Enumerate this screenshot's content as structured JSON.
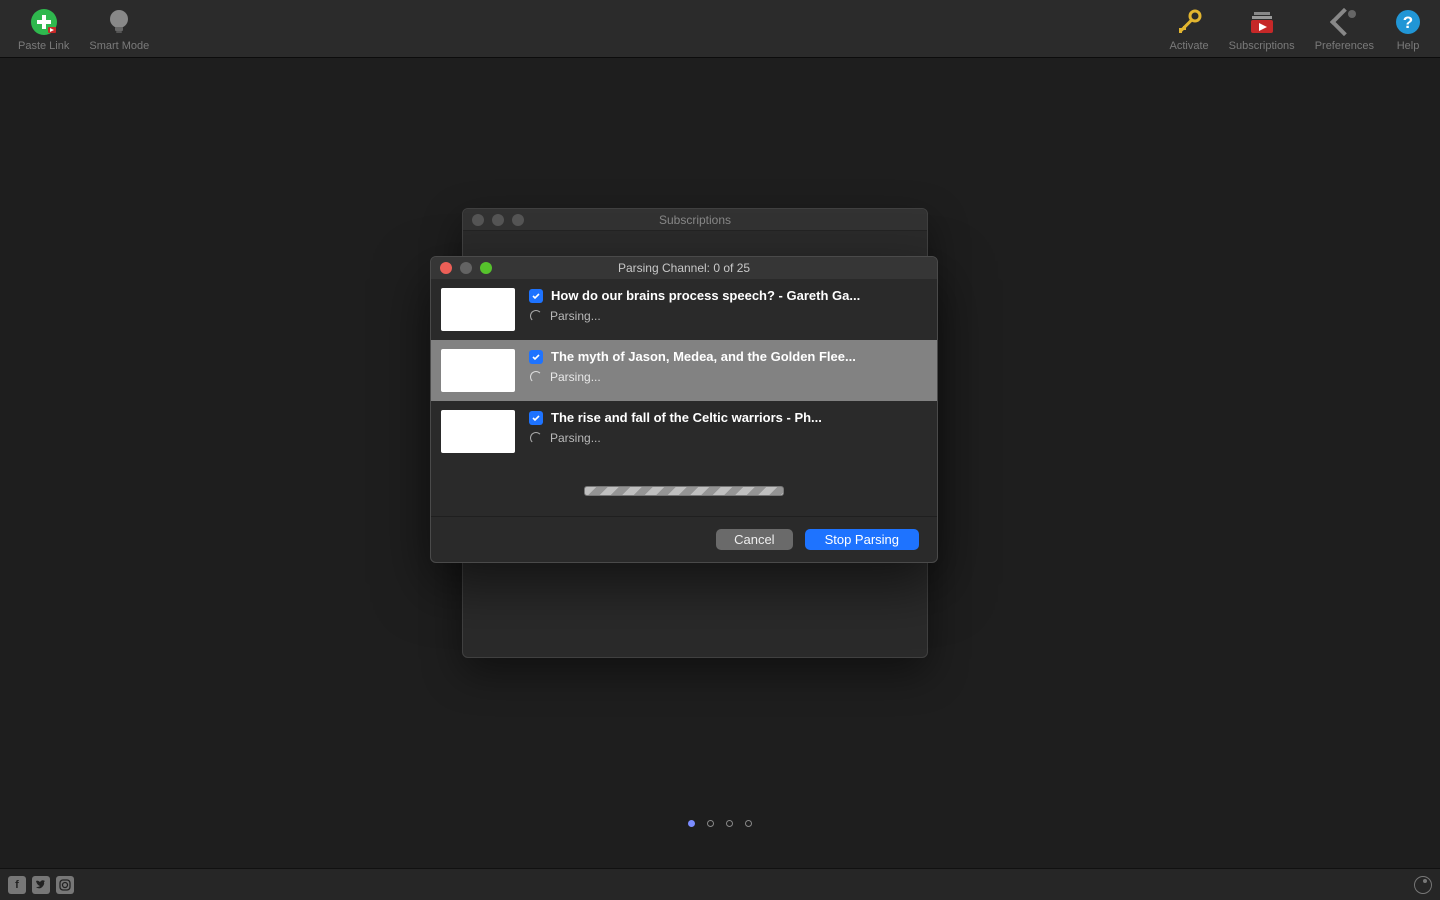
{
  "toolbar": {
    "left": [
      {
        "label": "Paste Link",
        "name": "paste-link-button"
      },
      {
        "label": "Smart Mode",
        "name": "smart-mode-button"
      }
    ],
    "right": [
      {
        "label": "Activate",
        "name": "activate-button"
      },
      {
        "label": "Subscriptions",
        "name": "subscriptions-button"
      },
      {
        "label": "Preferences",
        "name": "preferences-button"
      },
      {
        "label": "Help",
        "name": "help-button"
      }
    ]
  },
  "subscriptions": {
    "title": "Subscriptions"
  },
  "parsing": {
    "title": "Parsing Channel: 0 of 25",
    "current": 0,
    "total": 25,
    "items": [
      {
        "title": "How do our brains process speech? - Gareth Ga...",
        "status": "Parsing...",
        "checked": true
      },
      {
        "title": "The myth of Jason, Medea, and the Golden Flee...",
        "status": "Parsing...",
        "checked": true
      },
      {
        "title": "The rise and fall of the Celtic warriors - Ph...",
        "status": "Parsing...",
        "checked": true
      }
    ],
    "cancel_label": "Cancel",
    "stop_label": "Stop Parsing"
  },
  "pager": {
    "count": 4,
    "active": 0
  }
}
